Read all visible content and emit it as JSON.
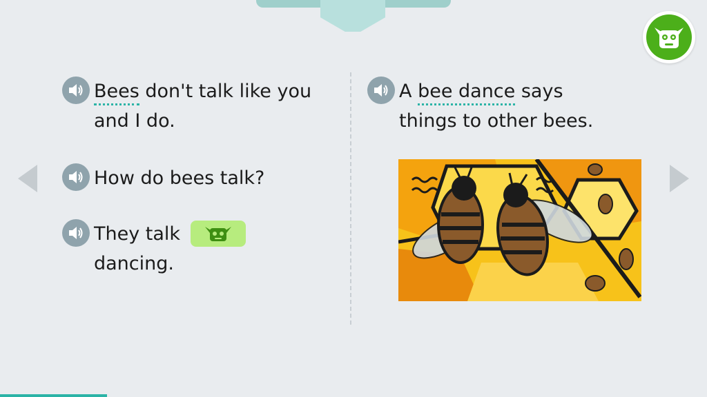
{
  "left_column": {
    "sentences": [
      {
        "pre": "",
        "vocab": "Bees",
        "post": " don't talk like you",
        "line2": "and I do."
      },
      {
        "text": "How do bees talk?"
      },
      {
        "pre": "They talk",
        "line2": "dancing."
      }
    ]
  },
  "right_column": {
    "sentence": {
      "pre": "A ",
      "vocab": "bee dance",
      "post": " says",
      "line2": "things to other bees."
    },
    "image_alt": "bee-dance-illustration"
  },
  "icons": {
    "speaker": "speaker-icon",
    "mascot": "goblin-mascot-icon",
    "prev": "chevron-left-icon",
    "next": "chevron-right-icon"
  },
  "colors": {
    "background": "#e9ecef",
    "accent_teal": "#2bb3a6",
    "speaker_bg": "#8fa3ac",
    "mascot_green": "#4caf1a",
    "chip_green": "#b7ec7e"
  }
}
